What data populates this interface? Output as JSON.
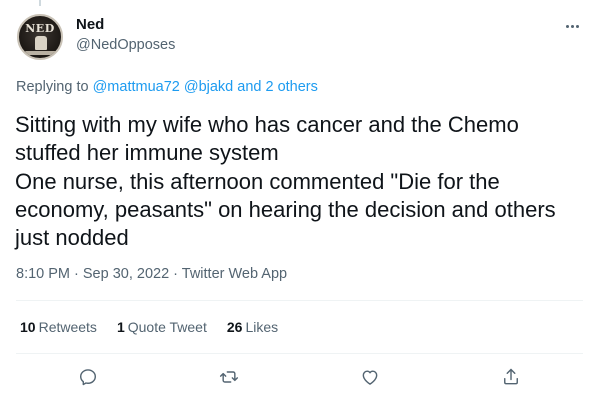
{
  "author": {
    "display_name": "Ned",
    "handle": "@NedOpposes",
    "avatar_text": "NED"
  },
  "replying": {
    "prefix": "Replying to ",
    "mentions": "@mattmua72 @bjakd and 2 others"
  },
  "tweet": {
    "lines": [
      "Sitting with my wife who has cancer and the Chemo",
      "stuffed her immune system",
      "One nurse, this afternoon commented \"Die for the",
      "economy, peasants\" on hearing the decision and others",
      "just nodded"
    ]
  },
  "meta": {
    "timestamp": "8:10 PM · Sep 30, 2022 · Twitter Web App"
  },
  "stats": {
    "retweets_count": "10",
    "retweets_label": "Retweets",
    "quotes_count": "1",
    "quotes_label": "Quote Tweet",
    "likes_count": "26",
    "likes_label": "Likes"
  },
  "actions": {
    "reply_icon": "speech-bubble-icon",
    "retweet_icon": "retweet-icon",
    "like_icon": "heart-icon",
    "share_icon": "share-icon"
  },
  "colors": {
    "text": "#0f1419",
    "secondary": "#536471",
    "link": "#1d9bf0",
    "divider": "#eff3f4"
  }
}
